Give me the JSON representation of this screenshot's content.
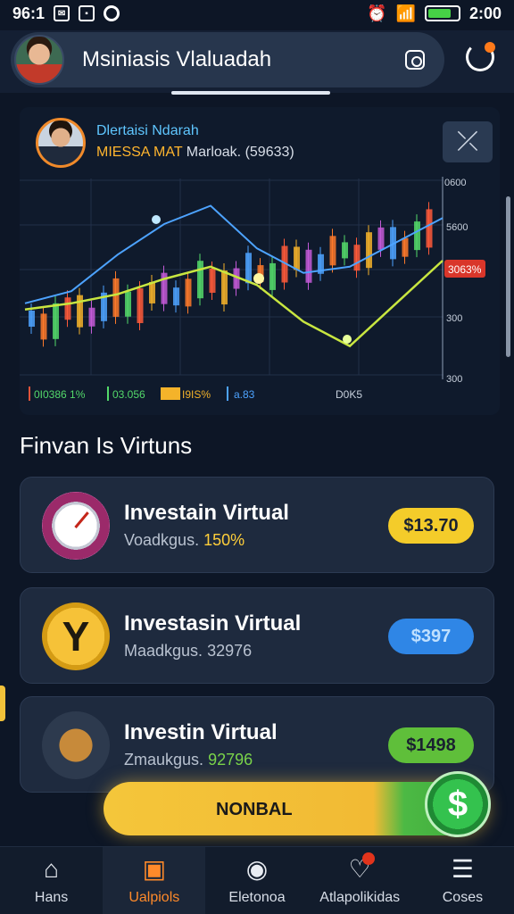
{
  "status_bar": {
    "time_left": "96:1",
    "time_right": "2:00"
  },
  "header": {
    "title": "Msiniasis Vlaluadah"
  },
  "chart_card": {
    "name": "Dlertaisi Ndarah",
    "sub_highlight": "MIESSA MAT",
    "sub_rest": " Marloak. (59633)",
    "badge": "3063%",
    "footer": {
      "item1": "0I0386 1%",
      "item2": "03.056",
      "item3": "I9IS%",
      "item4": "a.83",
      "item5": "D0K5"
    }
  },
  "chart_data": {
    "type": "line",
    "y_tick_labels": [
      "0600",
      "5600",
      "300",
      "300"
    ],
    "series": [
      {
        "color": "#4da3ff",
        "values": [
          52,
          56,
          68,
          78,
          84,
          70,
          62,
          64,
          72,
          80
        ]
      },
      {
        "color": "#c8e640",
        "values": [
          50,
          52,
          55,
          60,
          64,
          58,
          46,
          38,
          52,
          66
        ]
      }
    ]
  },
  "section_title": "Finvan Is Virtuns",
  "cards": [
    {
      "title": "Investain Virtual",
      "sub_label": "Voadkgus.",
      "sub_value": "150%",
      "price": "$13.70",
      "price_color": "#f4cc2a"
    },
    {
      "title": "Investasin Virtual",
      "sub_label": "Maadkgus.",
      "sub_value": "32976",
      "price": "$397",
      "price_color": "#2f86e6"
    },
    {
      "title": "Investin Virtual",
      "sub_label": "Zmaukgus.",
      "sub_value": "92796",
      "price": "$1498",
      "price_color": "#5fbf3a"
    }
  ],
  "cta": {
    "label": "NONBAL",
    "coin": "$"
  },
  "bottom_nav": [
    {
      "label": "Hans",
      "icon": "home-icon"
    },
    {
      "label": "Ualpiols",
      "icon": "briefcase-icon"
    },
    {
      "label": "Eletonoa",
      "icon": "compass-icon"
    },
    {
      "label": "Atlapolikidas",
      "icon": "heart-icon"
    },
    {
      "label": "Coses",
      "icon": "menu-icon"
    }
  ]
}
